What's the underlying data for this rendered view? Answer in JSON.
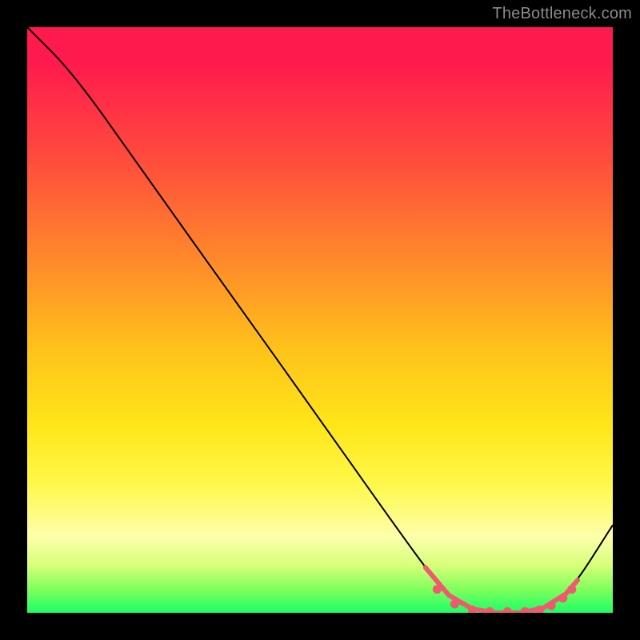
{
  "watermark": "TheBottleneck.com",
  "colors": {
    "marker": "#ef5b6e",
    "line": "#000000",
    "gradient_top": "#ff1a4d",
    "gradient_bottom": "#1aff66"
  },
  "chart_data": {
    "type": "line",
    "title": "",
    "xlabel": "",
    "ylabel": "",
    "xlim": [
      0,
      100
    ],
    "ylim": [
      0,
      100
    ],
    "grid": false,
    "legend": false,
    "series": [
      {
        "name": "curve",
        "x": [
          0,
          8,
          20,
          35,
          50,
          62,
          70,
          74,
          80,
          85,
          89,
          93,
          100
        ],
        "values": [
          100,
          92,
          75,
          54,
          33,
          16,
          5,
          1,
          0,
          0,
          1,
          4,
          15
        ]
      }
    ],
    "markers": {
      "name": "valley-dots",
      "x": [
        70,
        73,
        76,
        79,
        82,
        85,
        87.5,
        89.5,
        91.5,
        93
      ],
      "values": [
        4,
        1.5,
        0.5,
        0.2,
        0.2,
        0.2,
        0.5,
        1.2,
        2.5,
        4
      ]
    }
  }
}
